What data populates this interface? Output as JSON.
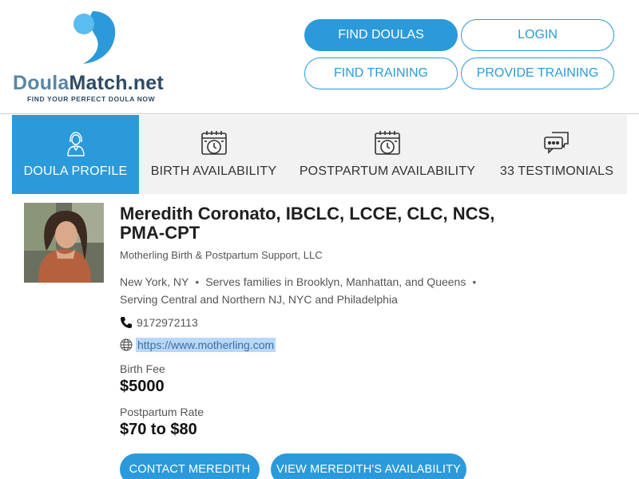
{
  "brand": {
    "name_part1": "Doula",
    "name_part2": "Match.net",
    "tagline": "FIND YOUR PERFECT DOULA NOW",
    "colors": {
      "primary": "#2b9adb",
      "light": "#5bbcf0",
      "navy": "#2c4b66"
    }
  },
  "nav": {
    "find_doulas": "FIND DOULAS",
    "login": "LOGIN",
    "find_training": "FIND TRAINING",
    "provide_training": "PROVIDE TRAINING"
  },
  "tabs": [
    {
      "label": "DOULA PROFILE",
      "icon": "doula-person-icon",
      "active": true
    },
    {
      "label": "BIRTH AVAILABILITY",
      "icon": "calendar-clock-icon",
      "active": false
    },
    {
      "label": "POSTPARTUM AVAILABILITY",
      "icon": "calendar-clock-icon",
      "active": false
    },
    {
      "label": "33 TESTIMONIALS",
      "icon": "chat-bubbles-icon",
      "active": false
    }
  ],
  "profile": {
    "name": "Meredith Coronato, IBCLC, LCCE, CLC, NCS, PMA-CPT",
    "organization": "Motherling Birth & Postpartum Support, LLC",
    "location_city": "New York, NY",
    "location_serves": "Serves families in Brooklyn, Manhattan, and Queens",
    "location_serving": "Serving Central and Northern NJ, NYC and Philadelphia",
    "separator": "•",
    "phone": "9172972113",
    "website": "https://www.motherling.com",
    "birth_fee_label": "Birth Fee",
    "birth_fee_value": "$5000",
    "postpartum_rate_label": "Postpartum Rate",
    "postpartum_rate_value": "$70 to $80"
  },
  "actions": {
    "contact": "CONTACT MEREDITH",
    "availability": "VIEW MEREDITH'S AVAILABILITY"
  }
}
